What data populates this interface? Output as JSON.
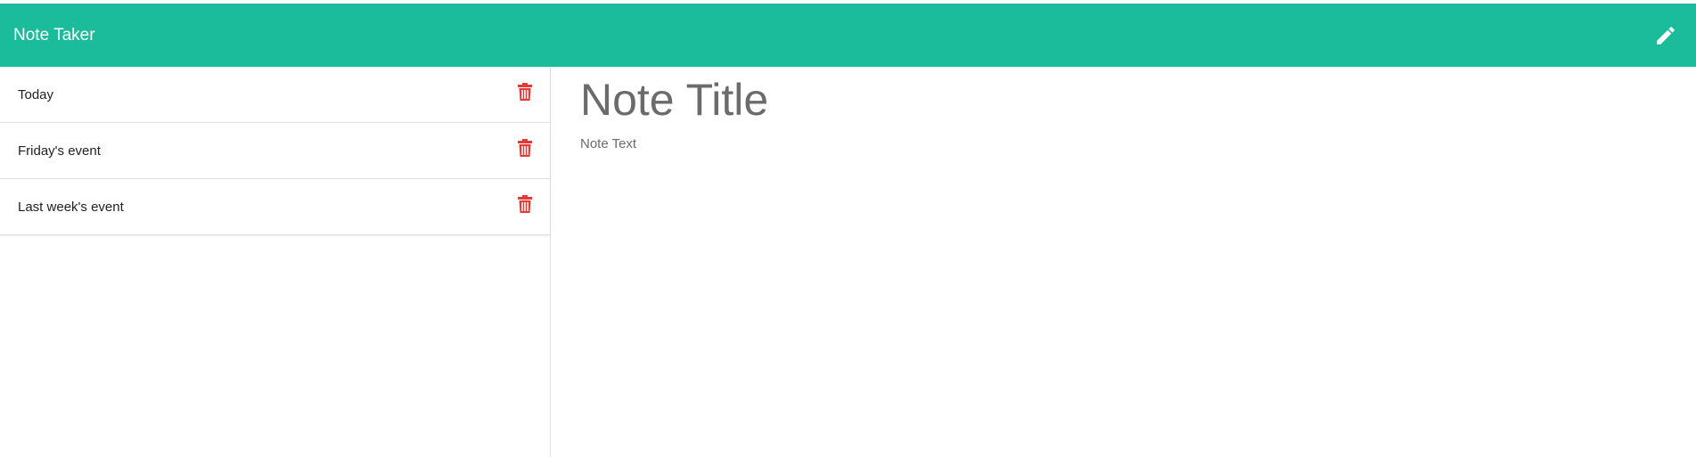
{
  "navbar": {
    "brand": "Note Taker",
    "new_note_icon": "pencil-icon"
  },
  "colors": {
    "navbar_bg": "#1abc9c",
    "delete_icon": "#e53935"
  },
  "notes": [
    {
      "title": "Today",
      "delete_icon": "trash-icon"
    },
    {
      "title": "Friday's event",
      "delete_icon": "trash-icon"
    },
    {
      "title": "Last week's event",
      "delete_icon": "trash-icon"
    }
  ],
  "editor": {
    "title_placeholder": "Note Title",
    "text_placeholder": "Note Text"
  }
}
